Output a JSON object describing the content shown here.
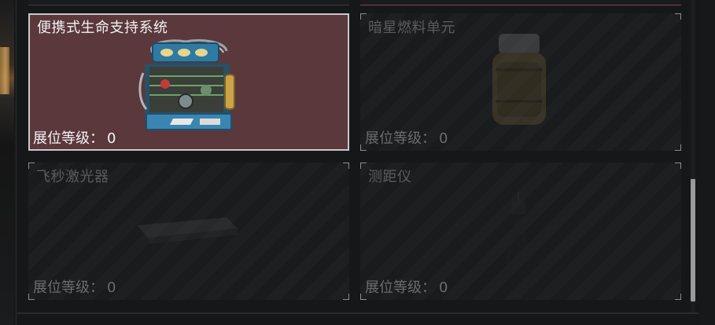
{
  "items": [
    {
      "name": "便携式生命支持系统",
      "level_label": "展位等级：",
      "level_value": "0",
      "selected": true,
      "icon": "life-support-system-icon"
    },
    {
      "name": "暗星燃料单元",
      "level_label": "展位等级：",
      "level_value": "0",
      "selected": false,
      "icon": "fuel-canister-icon"
    },
    {
      "name": "飞秒激光器",
      "level_label": "展位等级：",
      "level_value": "0",
      "selected": false,
      "icon": "laser-device-icon"
    },
    {
      "name": "测距仪",
      "level_label": "展位等级：",
      "level_value": "0",
      "selected": false,
      "icon": "rangefinder-tripod-icon"
    }
  ],
  "colors": {
    "selected_bg": "#5a383c",
    "selected_border": "#c9c9c9",
    "card_bg": "#1a1b1d"
  }
}
